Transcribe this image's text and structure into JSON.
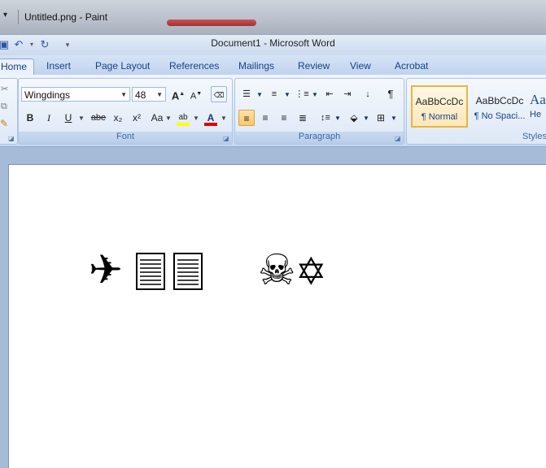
{
  "paint": {
    "title": "Untitled.png - Paint"
  },
  "word": {
    "title": "Document1 - Microsoft Word",
    "tabs": [
      "Home",
      "Insert",
      "Page Layout",
      "References",
      "Mailings",
      "Review",
      "View",
      "Acrobat"
    ],
    "active_tab": "Home"
  },
  "font": {
    "name": "Wingdings",
    "size": "48",
    "group_label": "Font",
    "buttons": {
      "bold": "B",
      "italic": "I",
      "underline": "U",
      "strike": "abe",
      "subscript": "x₂",
      "superscript": "x²",
      "change_case": "Aa",
      "grow": "A",
      "shrink": "A"
    },
    "highlight_color": "#ffff00",
    "font_color": "#e00000"
  },
  "paragraph": {
    "group_label": "Paragraph",
    "alignment": "left"
  },
  "styles": {
    "group_label": "Styles",
    "items": [
      {
        "sample": "AaBbCcDc",
        "name": "¶ Normal"
      },
      {
        "sample": "AaBbCcDc",
        "name": "¶ No Spaci..."
      },
      {
        "sample": "Aa",
        "name": "He"
      }
    ],
    "selected": "¶ Normal"
  },
  "document": {
    "glyphs": [
      {
        "icon": "airplane-icon",
        "char": "✈"
      },
      {
        "icon": "document-icon",
        "char": ""
      },
      {
        "icon": "document-icon",
        "char": ""
      },
      {
        "icon": "skull-crossbones-icon",
        "char": "☠"
      },
      {
        "icon": "star-of-david-icon",
        "char": "✡"
      }
    ]
  }
}
